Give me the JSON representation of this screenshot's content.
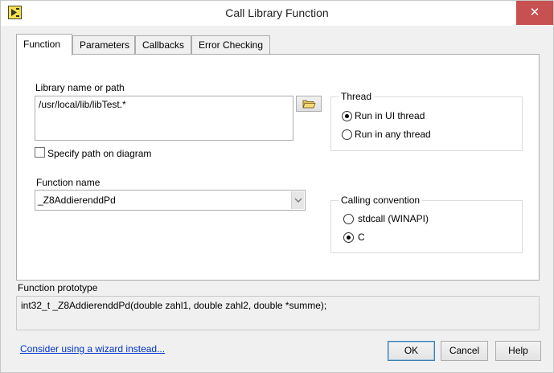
{
  "window": {
    "title": "Call Library Function",
    "close_glyph": "✕"
  },
  "tabs": [
    {
      "label": "Function",
      "active": true
    },
    {
      "label": "Parameters",
      "active": false
    },
    {
      "label": "Callbacks",
      "active": false
    },
    {
      "label": "Error Checking",
      "active": false
    }
  ],
  "library": {
    "label": "Library name or path",
    "value": "/usr/local/lib/libTest.*",
    "specify_path_label": "Specify path on diagram",
    "specify_path_checked": false
  },
  "thread": {
    "title": "Thread",
    "options": [
      {
        "label": "Run in UI thread",
        "checked": true
      },
      {
        "label": "Run in any thread",
        "checked": false
      }
    ]
  },
  "function": {
    "label": "Function name",
    "value": "_Z8AddierenddPd"
  },
  "calling_convention": {
    "title": "Calling convention",
    "options": [
      {
        "label": "stdcall (WINAPI)",
        "checked": false
      },
      {
        "label": "C",
        "checked": true
      }
    ]
  },
  "prototype": {
    "label": "Function prototype",
    "text": "int32_t _Z8AddierenddPd(double zahl1, double zahl2, double *summe);"
  },
  "footer": {
    "wizard_link": "Consider using a wizard instead...",
    "ok_label": "OK",
    "cancel_label": "Cancel",
    "help_label": "Help"
  },
  "icons": {
    "app": "labview-cln-icon",
    "browse": "folder-open-icon",
    "dropdown": "chevron-down-icon"
  },
  "colors": {
    "close_button": "#c75050",
    "link": "#0033cc"
  }
}
